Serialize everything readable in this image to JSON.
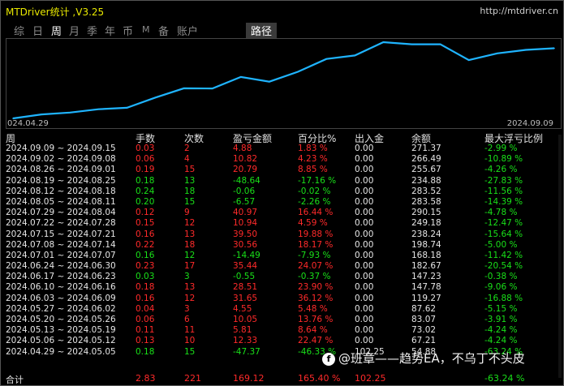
{
  "titlebar": {
    "app_title": "MTDriver统计 ,V3.25",
    "site": "http://mtdriver.cn"
  },
  "tabs": [
    {
      "label": "综"
    },
    {
      "label": "日"
    },
    {
      "label": "周"
    },
    {
      "label": "月"
    },
    {
      "label": "季"
    },
    {
      "label": "年"
    },
    {
      "label": "币"
    },
    {
      "label": "M"
    },
    {
      "label": "备"
    },
    {
      "label": "账户"
    },
    {
      "label": "路径"
    }
  ],
  "chart_data": {
    "type": "line",
    "x": [
      "2024.04.29",
      "2024.05.06",
      "2024.05.13",
      "2024.05.20",
      "2024.05.27",
      "2024.06.03",
      "2024.06.10",
      "2024.06.17",
      "2024.06.24",
      "2024.07.01",
      "2024.07.08",
      "2024.07.15",
      "2024.07.22",
      "2024.07.29",
      "2024.08.05",
      "2024.08.12",
      "2024.08.19",
      "2024.08.26",
      "2024.09.02",
      "2024.09.09"
    ],
    "y": [
      54.0,
      66.33,
      72.14,
      82.19,
      86.74,
      118.39,
      146.9,
      146.35,
      181.79,
      167.3,
      197.86,
      237.36,
      248.3,
      289.27,
      282.7,
      282.64,
      233.96,
      254.75,
      265.57,
      270.45
    ],
    "start_label": "024.04.29",
    "end_label": "2024.09.09",
    "color": "#1fb4ff"
  },
  "table": {
    "headers": [
      "周",
      "手数",
      "次数",
      "盈亏金额",
      "百分比%",
      "出入金",
      "余额",
      "最大浮亏比例"
    ],
    "rows": [
      {
        "week": "2024.09.09 ~ 2024.09.15",
        "lots": "0.03",
        "count": "2",
        "pl": "4.88",
        "pct": "1.83 %",
        "io": "0.00",
        "bal": "271.37",
        "dd": "-2.99 %",
        "c": "r"
      },
      {
        "week": "2024.09.02 ~ 2024.09.08",
        "lots": "0.06",
        "count": "4",
        "pl": "10.82",
        "pct": "4.23 %",
        "io": "0.00",
        "bal": "266.49",
        "dd": "-10.89 %",
        "c": "r"
      },
      {
        "week": "2024.08.26 ~ 2024.09.01",
        "lots": "0.19",
        "count": "15",
        "pl": "20.79",
        "pct": "8.85 %",
        "io": "0.00",
        "bal": "255.67",
        "dd": "-4.26 %",
        "c": "r"
      },
      {
        "week": "2024.08.19 ~ 2024.08.25",
        "lots": "0.18",
        "count": "13",
        "pl": "-48.64",
        "pct": "-17.16 %",
        "io": "0.00",
        "bal": "234.88",
        "dd": "-27.83 %",
        "c": "g"
      },
      {
        "week": "2024.08.12 ~ 2024.08.18",
        "lots": "0.24",
        "count": "18",
        "pl": "-0.06",
        "pct": "-0.02 %",
        "io": "0.00",
        "bal": "283.52",
        "dd": "-11.56 %",
        "c": "g"
      },
      {
        "week": "2024.08.05 ~ 2024.08.11",
        "lots": "0.20",
        "count": "15",
        "pl": "-6.57",
        "pct": "-2.26 %",
        "io": "0.00",
        "bal": "283.58",
        "dd": "-14.39 %",
        "c": "g"
      },
      {
        "week": "2024.07.29 ~ 2024.08.04",
        "lots": "0.12",
        "count": "9",
        "pl": "40.97",
        "pct": "16.44 %",
        "io": "0.00",
        "bal": "290.15",
        "dd": "-4.78 %",
        "c": "r"
      },
      {
        "week": "2024.07.22 ~ 2024.07.28",
        "lots": "0.15",
        "count": "12",
        "pl": "10.94",
        "pct": "4.59 %",
        "io": "0.00",
        "bal": "249.18",
        "dd": "-12.47 %",
        "c": "r"
      },
      {
        "week": "2024.07.15 ~ 2024.07.21",
        "lots": "0.16",
        "count": "13",
        "pl": "39.50",
        "pct": "19.88 %",
        "io": "0.00",
        "bal": "238.24",
        "dd": "-15.64 %",
        "c": "r"
      },
      {
        "week": "2024.07.08 ~ 2024.07.14",
        "lots": "0.22",
        "count": "18",
        "pl": "30.56",
        "pct": "18.17 %",
        "io": "0.00",
        "bal": "198.74",
        "dd": "-5.00 %",
        "c": "r"
      },
      {
        "week": "2024.07.01 ~ 2024.07.07",
        "lots": "0.16",
        "count": "12",
        "pl": "-14.49",
        "pct": "-7.93 %",
        "io": "0.00",
        "bal": "168.18",
        "dd": "-11.42 %",
        "c": "g"
      },
      {
        "week": "2024.06.24 ~ 2024.06.30",
        "lots": "0.23",
        "count": "17",
        "pl": "35.44",
        "pct": "24.07 %",
        "io": "0.00",
        "bal": "182.67",
        "dd": "-20.54 %",
        "c": "r"
      },
      {
        "week": "2024.06.17 ~ 2024.06.23",
        "lots": "0.03",
        "count": "3",
        "pl": "-0.55",
        "pct": "-0.37 %",
        "io": "0.00",
        "bal": "147.23",
        "dd": "-0.38 %",
        "c": "g"
      },
      {
        "week": "2024.06.10 ~ 2024.06.16",
        "lots": "0.18",
        "count": "13",
        "pl": "28.51",
        "pct": "23.90 %",
        "io": "0.00",
        "bal": "147.78",
        "dd": "-9.06 %",
        "c": "r"
      },
      {
        "week": "2024.06.03 ~ 2024.06.09",
        "lots": "0.16",
        "count": "12",
        "pl": "31.65",
        "pct": "36.12 %",
        "io": "0.00",
        "bal": "119.27",
        "dd": "-16.88 %",
        "c": "r"
      },
      {
        "week": "2024.05.27 ~ 2024.06.02",
        "lots": "0.04",
        "count": "3",
        "pl": "4.55",
        "pct": "5.48 %",
        "io": "0.00",
        "bal": "87.62",
        "dd": "-5.15 %",
        "c": "r"
      },
      {
        "week": "2024.05.20 ~ 2024.05.26",
        "lots": "0.06",
        "count": "6",
        "pl": "10.05",
        "pct": "13.76 %",
        "io": "0.00",
        "bal": "83.07",
        "dd": "-3.91 %",
        "c": "r"
      },
      {
        "week": "2024.05.13 ~ 2024.05.19",
        "lots": "0.11",
        "count": "11",
        "pl": "5.81",
        "pct": "8.64 %",
        "io": "0.00",
        "bal": "73.02",
        "dd": "-4.24 %",
        "c": "r"
      },
      {
        "week": "2024.05.06 ~ 2024.05.12",
        "lots": "0.13",
        "count": "10",
        "pl": "12.33",
        "pct": "22.47 %",
        "io": "0.00",
        "bal": "67.21",
        "dd": "-4.24 %",
        "c": "r"
      },
      {
        "week": "2024.04.29 ~ 2024.05.05",
        "lots": "0.18",
        "count": "15",
        "pl": "-47.37",
        "pct": "-46.33 %",
        "io": "102.25",
        "bal": "54.88",
        "dd": "-63.24 %",
        "c": "g"
      }
    ],
    "total": {
      "label": "合计",
      "lots": "2.83",
      "count": "221",
      "pl": "169.12",
      "pct": "165.40 %",
      "io": "102.25",
      "bal": "",
      "dd": "-63.24 %"
    }
  },
  "watermark": {
    "logo": "f",
    "text": "@班章——趋势EA，不乌丁不头皮"
  }
}
